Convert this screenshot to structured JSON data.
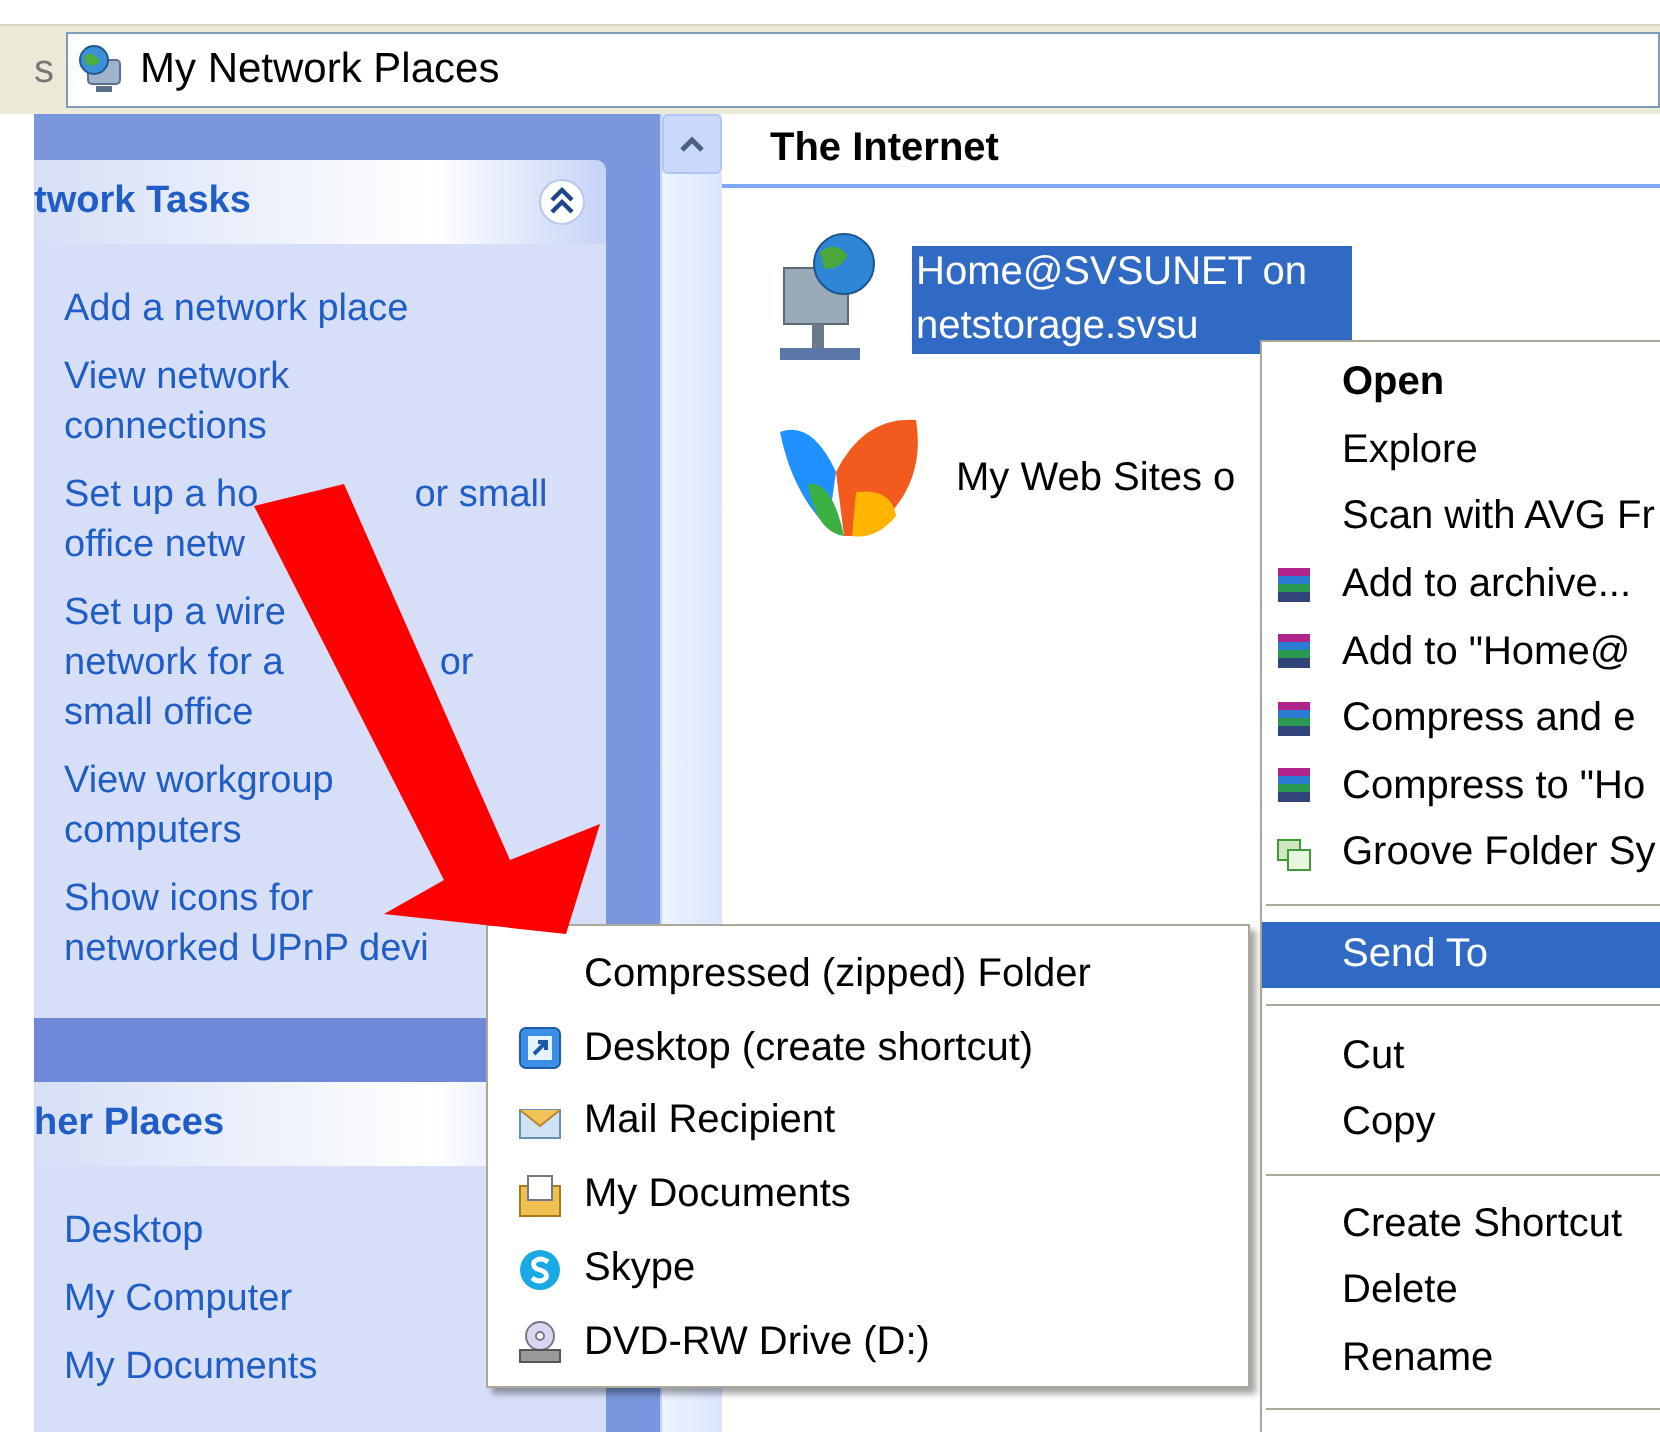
{
  "address_bar": {
    "label": "s",
    "value": "My Network Places"
  },
  "task_panels": [
    {
      "title": "twork Tasks",
      "links": [
        {
          "lines": [
            [
              "Add a network place"
            ]
          ]
        },
        {
          "lines": [
            [
              "View network"
            ],
            [
              "connections"
            ]
          ]
        },
        {
          "lines": [
            [
              "Set up a ho",
              "or small"
            ],
            [
              "office netw"
            ]
          ]
        },
        {
          "lines": [
            [
              "Set up a wire"
            ],
            [
              "network for a",
              "or"
            ],
            [
              "small office"
            ]
          ]
        },
        {
          "lines": [
            [
              "View workgroup"
            ],
            [
              "computers"
            ]
          ]
        },
        {
          "lines": [
            [
              "Show icons for"
            ],
            [
              "networked UPnP devi"
            ]
          ]
        }
      ]
    },
    {
      "title": "her Places",
      "links": [
        {
          "lines": [
            [
              "Desktop"
            ]
          ]
        },
        {
          "lines": [
            [
              "My Computer"
            ]
          ]
        },
        {
          "lines": [
            [
              "My Documents"
            ]
          ]
        }
      ]
    }
  ],
  "content": {
    "group_title": "The Internet",
    "items": [
      {
        "kind": "network",
        "label": "Home@SVSUNET on netstorage.svsu",
        "selected": true
      },
      {
        "kind": "web",
        "label": "My Web Sites o",
        "selected": false
      }
    ]
  },
  "context_menu": {
    "items": [
      {
        "kind": "plain",
        "label": "Open",
        "default": true,
        "selected": false
      },
      {
        "kind": "plain",
        "label": "Explore",
        "default": false,
        "selected": false
      },
      {
        "kind": "plain",
        "label": "Scan with AVG Fr",
        "default": false,
        "selected": false
      },
      {
        "kind": "archive",
        "label": "Add to archive...",
        "default": false,
        "selected": false
      },
      {
        "kind": "archive",
        "label": "Add to \"Home@",
        "default": false,
        "selected": false
      },
      {
        "kind": "archive",
        "label": "Compress and e",
        "default": false,
        "selected": false
      },
      {
        "kind": "archive",
        "label": "Compress to \"Ho",
        "default": false,
        "selected": false
      },
      {
        "kind": "sync",
        "label": "Groove Folder Sy",
        "default": false,
        "selected": false
      },
      {
        "kind": "separator"
      },
      {
        "kind": "plain",
        "label": "Send To",
        "default": false,
        "selected": true
      },
      {
        "kind": "separator"
      },
      {
        "kind": "plain",
        "label": "Cut",
        "default": false,
        "selected": false
      },
      {
        "kind": "plain",
        "label": "Copy",
        "default": false,
        "selected": false
      },
      {
        "kind": "separator"
      },
      {
        "kind": "plain",
        "label": "Create Shortcut",
        "default": false,
        "selected": false
      },
      {
        "kind": "plain",
        "label": "Delete",
        "default": false,
        "selected": false
      },
      {
        "kind": "plain",
        "label": "Rename",
        "default": false,
        "selected": false
      },
      {
        "kind": "separator"
      }
    ]
  },
  "send_to_menu": {
    "items": [
      {
        "kind": "zip",
        "label": "Compressed (zipped) Folder"
      },
      {
        "kind": "desktop",
        "label": "Desktop (create shortcut)"
      },
      {
        "kind": "mail",
        "label": "Mail Recipient"
      },
      {
        "kind": "documents",
        "label": "My Documents"
      },
      {
        "kind": "skype",
        "label": "Skype"
      },
      {
        "kind": "drive",
        "label": "DVD-RW Drive (D:)"
      }
    ]
  }
}
